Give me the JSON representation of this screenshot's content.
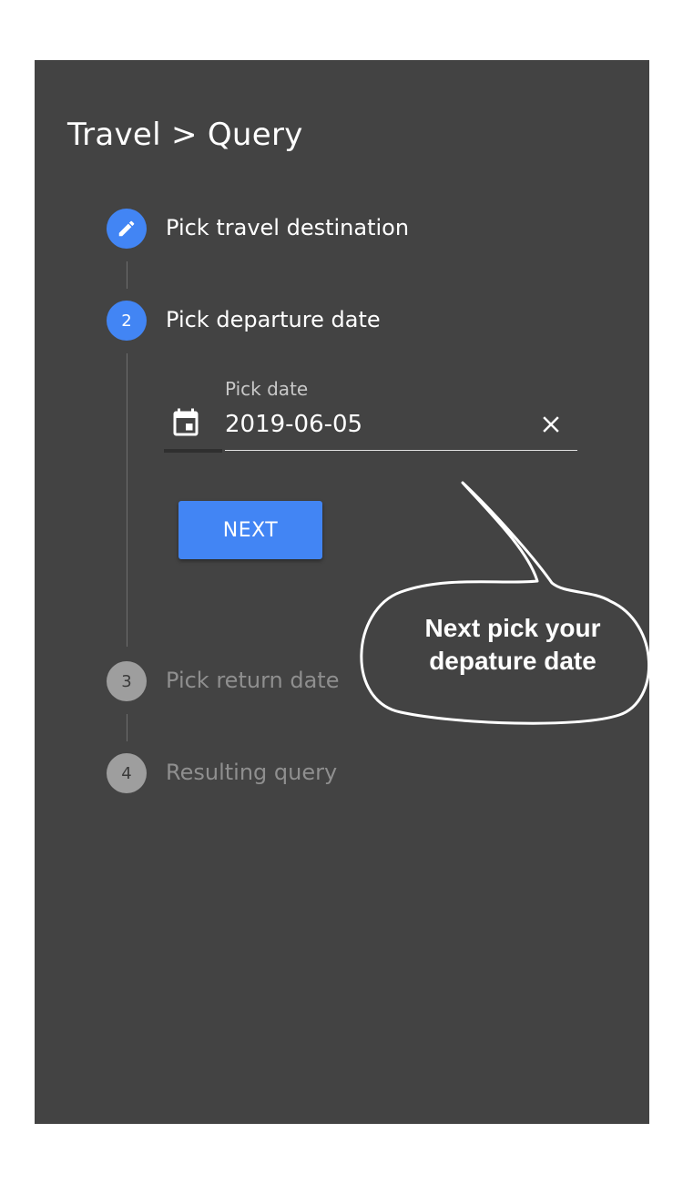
{
  "header": {
    "breadcrumb": "Travel > Query"
  },
  "stepper": {
    "steps": [
      {
        "marker": "",
        "label": "Pick travel destination",
        "state": "completed",
        "icon": "pencil-icon"
      },
      {
        "marker": "2",
        "label": "Pick departure date",
        "state": "active"
      },
      {
        "marker": "3",
        "label": "Pick return date",
        "state": "pending"
      },
      {
        "marker": "4",
        "label": "Resulting query",
        "state": "pending"
      }
    ]
  },
  "date_field": {
    "label": "Pick date",
    "value": "2019-06-05",
    "placeholder": "",
    "prefix_icon": "calendar-icon",
    "suffix_icon": "close-icon"
  },
  "actions": {
    "next_label": "NEXT"
  },
  "callout": {
    "line1": "Next pick your",
    "line2": "depature date"
  },
  "colors": {
    "panel_background": "#434343",
    "accent": "#4285f4",
    "inactive_step": "#9e9e9e",
    "inactive_text": "#8f8f8f",
    "text_primary": "#ffffff"
  }
}
